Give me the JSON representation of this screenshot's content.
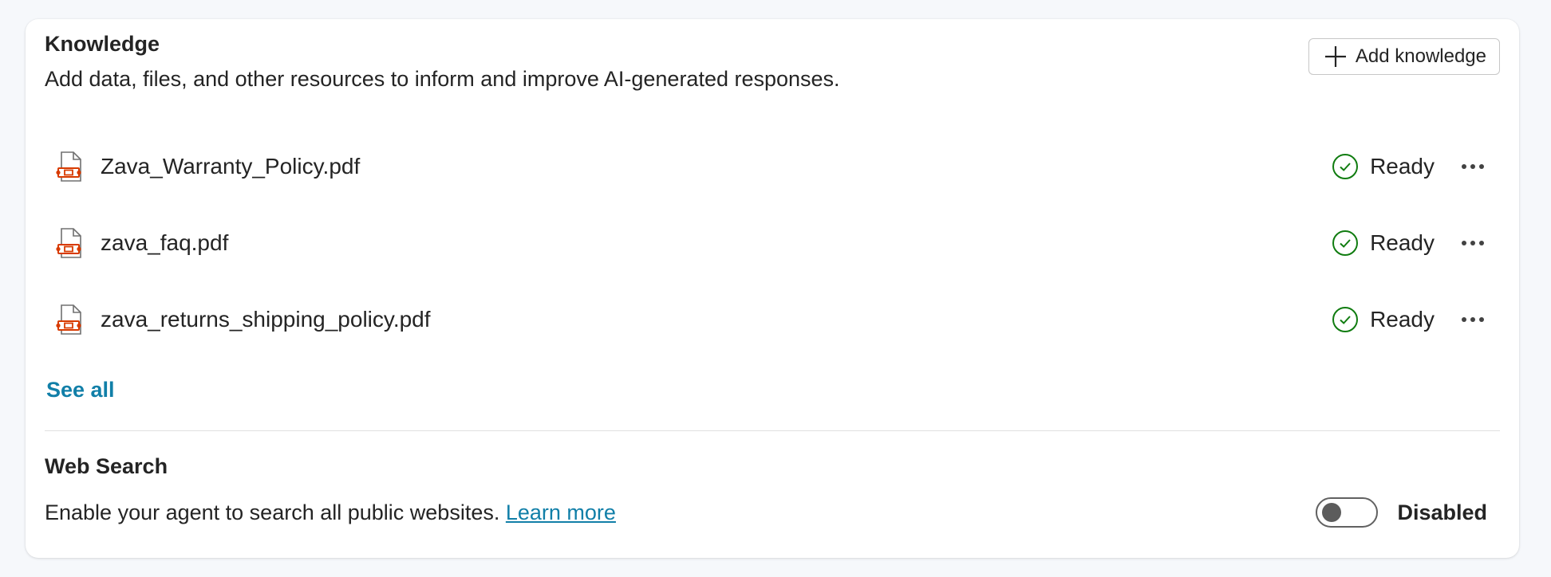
{
  "knowledge": {
    "title": "Knowledge",
    "description": "Add data, files, and other resources to inform and improve AI-generated responses.",
    "add_button_label": "Add knowledge",
    "files": [
      {
        "name": "Zava_Warranty_Policy.pdf",
        "status": "Ready",
        "icon": "pdf-file-icon"
      },
      {
        "name": "zava_faq.pdf",
        "status": "Ready",
        "icon": "pdf-file-icon"
      },
      {
        "name": "zava_returns_shipping_policy.pdf",
        "status": "Ready",
        "icon": "pdf-file-icon"
      }
    ],
    "see_all_label": "See all"
  },
  "web_search": {
    "title": "Web Search",
    "description": "Enable your agent to search all public websites.",
    "learn_more_label": "Learn more",
    "toggle_state": "Disabled",
    "enabled": false
  },
  "colors": {
    "link": "#117fa8",
    "ready_green": "#107c10",
    "pdf_red": "#d83b01"
  }
}
